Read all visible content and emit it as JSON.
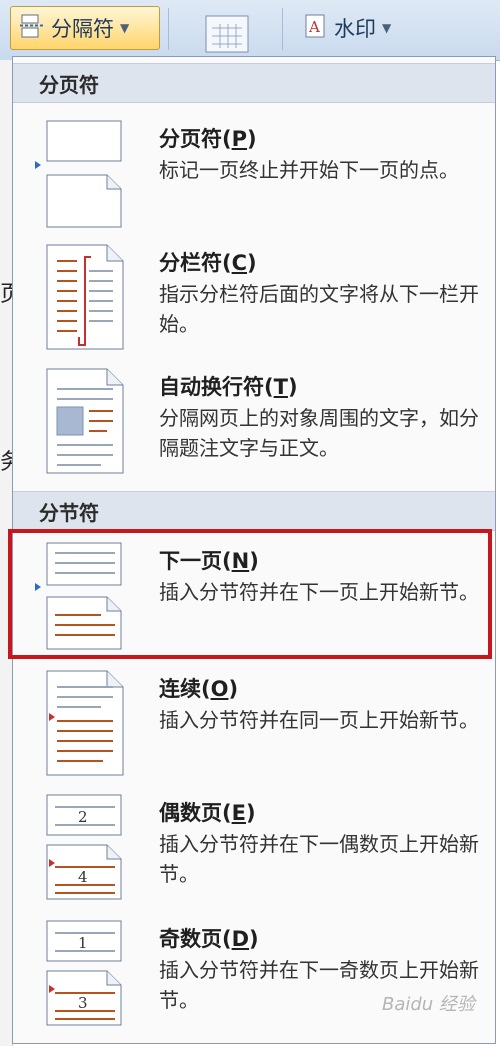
{
  "ribbon": {
    "breaks_button": "分隔符",
    "watermark_button": "水印"
  },
  "menu": {
    "page_breaks_header": "分页符",
    "section_breaks_header": "分节符",
    "items": [
      {
        "title": "分页符",
        "key": "P",
        "desc": "标记一页终止并开始下一页的点。"
      },
      {
        "title": "分栏符",
        "key": "C",
        "desc": "指示分栏符后面的文字将从下一栏开始。"
      },
      {
        "title": "自动换行符",
        "key": "T",
        "desc": "分隔网页上的对象周围的文字，如分隔题注文字与正文。"
      },
      {
        "title": "下一页",
        "key": "N",
        "desc": "插入分节符并在下一页上开始新节。"
      },
      {
        "title": "连续",
        "key": "O",
        "desc": "插入分节符并在同一页上开始新节。"
      },
      {
        "title": "偶数页",
        "key": "E",
        "desc": "插入分节符并在下一偶数页上开始新节。"
      },
      {
        "title": "奇数页",
        "key": "D",
        "desc": "插入分节符并在下一奇数页上开始新节。"
      }
    ]
  },
  "icon_labels": {
    "even_top": "2",
    "even_bottom": "4",
    "odd_top": "1",
    "odd_bottom": "3"
  },
  "watermark_text": "Baidu 经验",
  "colors": {
    "highlight": "#c8161d",
    "accent_line": "#b5551d",
    "header_bg": "#dde4ee"
  }
}
